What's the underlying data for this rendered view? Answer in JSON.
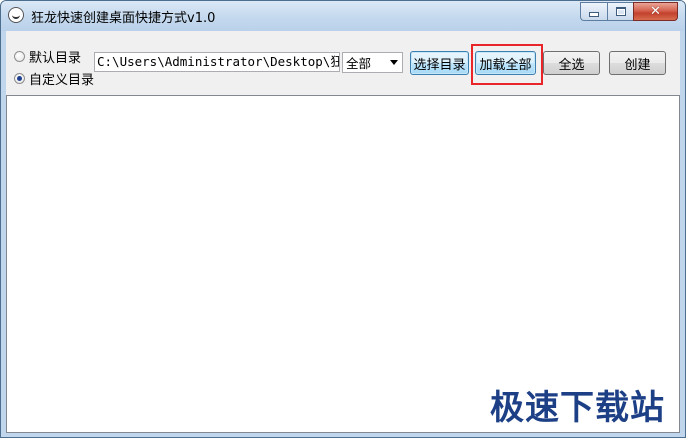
{
  "window": {
    "title": "狂龙快速创建桌面快捷方式v1.0",
    "close_glyph": "✕"
  },
  "toolbar": {
    "radio_default": "默认目录",
    "radio_custom": "自定义目录",
    "selected_radio": "custom",
    "path_value": "C:\\Users\\Administrator\\Desktop\\狂龙",
    "filter_selected": "全部",
    "btn_choose_dir": "选择目录",
    "btn_load_all": "加载全部",
    "btn_select_all": "全选",
    "btn_create": "创建"
  },
  "watermark": "极速下载站",
  "colors": {
    "highlight": "#e8262a",
    "watermark": "#1c3f86"
  }
}
